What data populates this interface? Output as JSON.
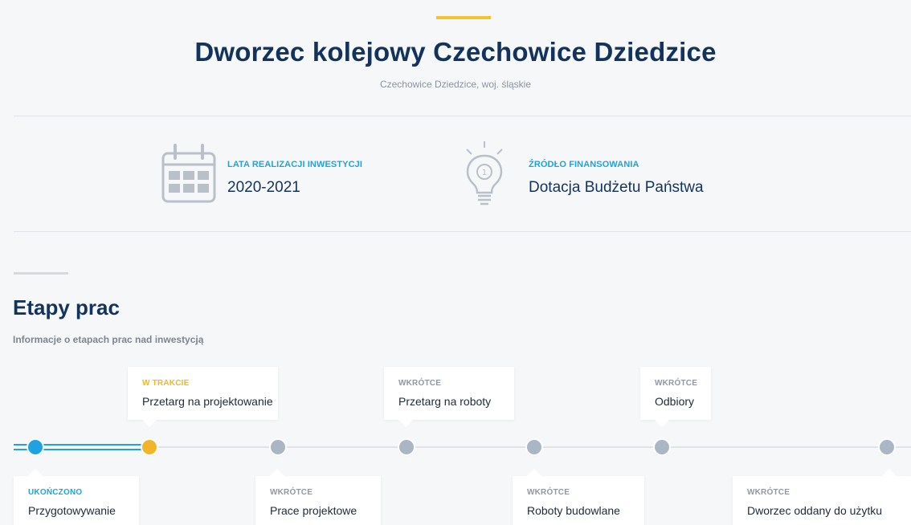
{
  "header": {
    "title": "Dworzec kolejowy Czechowice Dziedzice",
    "location": "Czechowice Dziedzice, woj. śląskie"
  },
  "info": [
    {
      "label": "LATA REALIZACJI INWESTYCJI",
      "value": "2020-2021",
      "icon": "calendar-icon"
    },
    {
      "label": "ŹRÓDŁO FINANSOWANIA",
      "value": "Dotacja Budżetu Państwa",
      "icon": "lightbulb-icon"
    }
  ],
  "stages": {
    "title": "Etapy prac",
    "subtitle": "Informacje o etapach prac nad inwestycją",
    "items": [
      {
        "status": "UKOŃCZONO",
        "name": "Przygotowywanie",
        "state": "done"
      },
      {
        "status": "W TRAKCIE",
        "name": "Przetarg na projektowanie",
        "state": "in-progress"
      },
      {
        "status": "WKRÓTCE",
        "name": "Prace projektowe",
        "state": "pending"
      },
      {
        "status": "WKRÓTCE",
        "name": "Przetarg na roboty",
        "state": "pending"
      },
      {
        "status": "WKRÓTCE",
        "name": "Roboty budowlane",
        "state": "pending"
      },
      {
        "status": "WKRÓTCE",
        "name": "Odbiory",
        "state": "pending"
      },
      {
        "status": "WKRÓTCE",
        "name": "Dworzec oddany do użytku",
        "state": "pending"
      }
    ]
  },
  "colors": {
    "accent": "#f2c230",
    "done": "#1fa3e0",
    "in_progress": "#f2b52a",
    "pending": "#aab6c4",
    "title": "#13335f"
  }
}
